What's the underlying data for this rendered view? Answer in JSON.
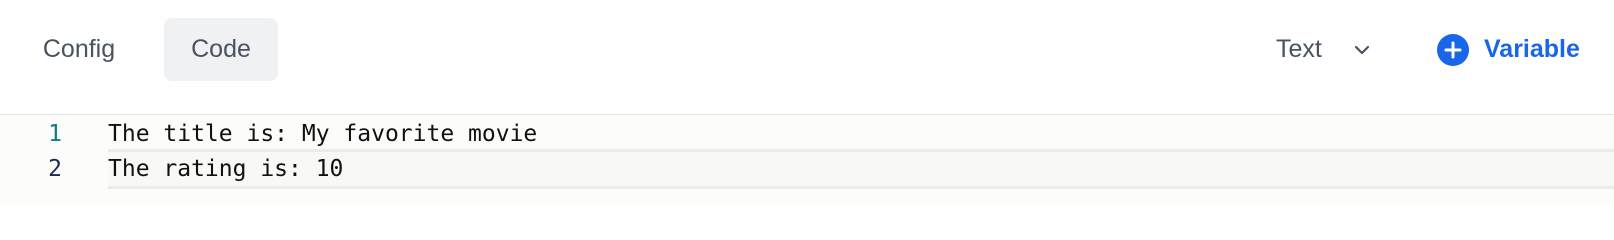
{
  "toolbar": {
    "tabs": [
      {
        "label": "Config"
      },
      {
        "label": "Code"
      }
    ],
    "mode_select": {
      "label": "Text",
      "icon": "chevron-down-icon"
    },
    "add_variable": {
      "label": "Variable",
      "icon": "plus-circle-icon"
    }
  },
  "colors": {
    "accent": "#1a66e8",
    "tab_active_bg": "#eff1f3",
    "text_muted": "#4a5361"
  },
  "editor": {
    "lines": [
      {
        "number": "1",
        "text": "The title is: My favorite movie"
      },
      {
        "number": "2",
        "text": "The rating is: 10"
      }
    ]
  }
}
